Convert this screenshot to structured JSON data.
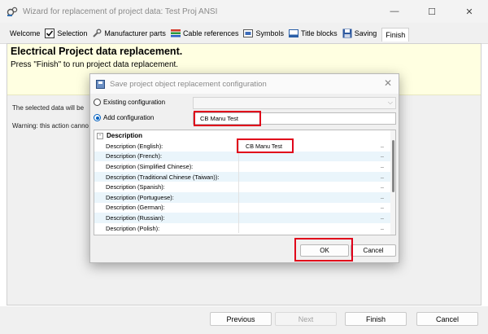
{
  "window": {
    "title": "Wizard for replacement of project data: Test Proj ANSI",
    "minimize": "—",
    "maximize": "☐",
    "close": "✕"
  },
  "tabs": [
    {
      "label": "Welcome",
      "icon": ""
    },
    {
      "label": "Selection",
      "icon": "checkbox-icon"
    },
    {
      "label": "Manufacturer parts",
      "icon": "wrench-icon"
    },
    {
      "label": "Cable references",
      "icon": "cable-icon"
    },
    {
      "label": "Symbols",
      "icon": "symbol-icon"
    },
    {
      "label": "Title blocks",
      "icon": "title-block-icon"
    },
    {
      "label": "Saving",
      "icon": "floppy-disk-icon"
    },
    {
      "label": "Finish",
      "icon": ""
    }
  ],
  "header": {
    "title": "Electrical Project data replacement.",
    "subtitle": "Press \"Finish\" to run project data replacement."
  },
  "body": {
    "line1": "The selected data will be",
    "line2": "Warning: this action canno"
  },
  "wizard_buttons": {
    "previous": "Previous",
    "next": "Next",
    "finish": "Finish",
    "cancel": "Cancel"
  },
  "dialog": {
    "title": "Save project object replacement configuration",
    "close": "✕",
    "existing_label": "Existing configuration",
    "add_label": "Add configuration",
    "add_value": "CB Manu Test",
    "section_title": "Description",
    "rows": [
      {
        "label": "Description (English):",
        "value": "CB Manu Test"
      },
      {
        "label": "Description (French):",
        "value": ""
      },
      {
        "label": "Description (Simplified Chinese):",
        "value": ""
      },
      {
        "label": "Description (Traditional Chinese (Taiwan)):",
        "value": ""
      },
      {
        "label": "Description (Spanish):",
        "value": ""
      },
      {
        "label": "Description (Portuguese):",
        "value": ""
      },
      {
        "label": "Description (German):",
        "value": ""
      },
      {
        "label": "Description (Russian):",
        "value": ""
      },
      {
        "label": "Description (Polish):",
        "value": ""
      }
    ],
    "ok": "OK",
    "cancel": "Cancel"
  },
  "colors": {
    "highlight": "#e0001a",
    "header_bg": "#ffffe1",
    "row_alt": "#eaf5fb",
    "radio_accent": "#0060c0"
  }
}
